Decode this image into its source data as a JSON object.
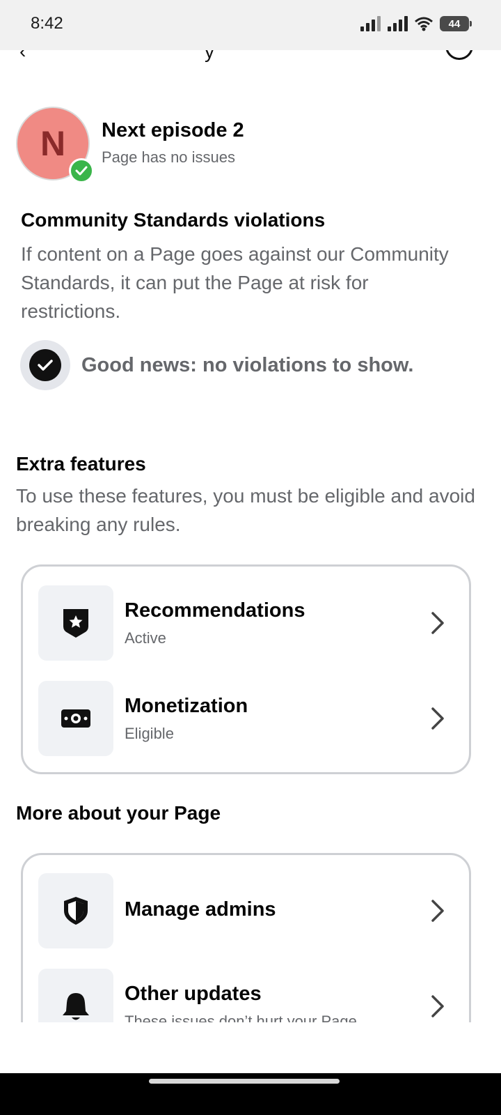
{
  "status_bar": {
    "time": "8:42",
    "battery": "44"
  },
  "page": {
    "avatar_letter": "N",
    "name": "Next episode 2",
    "status": "Page has no issues"
  },
  "community_standards": {
    "title": "Community Standards violations",
    "description": "If content on a Page goes against our Community Standards, it can put the Page at risk for restrictions.",
    "good_news": "Good news: no violations to show."
  },
  "extra_features": {
    "title": "Extra features",
    "description": "To use these features, you must be eligible and avoid breaking any rules.",
    "items": [
      {
        "icon": "shield-star-icon",
        "title": "Recommendations",
        "subtitle": "Active"
      },
      {
        "icon": "money-icon",
        "title": "Monetization",
        "subtitle": "Eligible"
      }
    ]
  },
  "more_about": {
    "title": "More about your Page",
    "items": [
      {
        "icon": "shield-icon",
        "title": "Manage admins",
        "subtitle": ""
      },
      {
        "icon": "bell-icon",
        "title": "Other updates",
        "subtitle": "These issues don’t hurt your Page,"
      }
    ]
  },
  "colors": {
    "avatar_bg": "#f08a84",
    "verified": "#3ab54a",
    "secondary_text": "#65676b"
  }
}
